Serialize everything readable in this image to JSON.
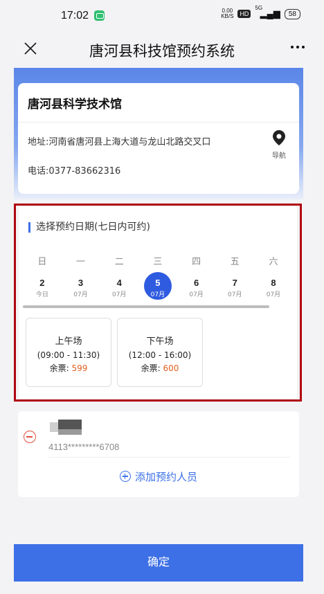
{
  "status_bar": {
    "time": "17:02",
    "net_speed_value": "0.00",
    "net_speed_unit": "KB/S",
    "hd": "HD",
    "network": "5G",
    "battery": "58"
  },
  "header": {
    "title": "唐河县科技馆预约系统"
  },
  "venue": {
    "name": "唐河县科学技术馆",
    "address": "地址:河南省唐河县上海大道与龙山北路交叉口",
    "phone": "电话:0377-83662316",
    "nav_label": "导航"
  },
  "date_picker": {
    "title": "选择预约日期(七日内可约)",
    "weekdays": [
      "日",
      "一",
      "二",
      "三",
      "四",
      "五",
      "六"
    ],
    "dates": [
      {
        "day": "2",
        "sub": "今日"
      },
      {
        "day": "3",
        "sub": "07月"
      },
      {
        "day": "4",
        "sub": "07月"
      },
      {
        "day": "5",
        "sub": "07月"
      },
      {
        "day": "6",
        "sub": "07月"
      },
      {
        "day": "7",
        "sub": "07月"
      },
      {
        "day": "8",
        "sub": "07月"
      }
    ],
    "selected_index": 3,
    "slots": [
      {
        "name": "上午场",
        "time": "(09:00 - 11:30)",
        "remain_label": "余票:",
        "remain": "599"
      },
      {
        "name": "下午场",
        "time": "(12:00 - 16:00)",
        "remain_label": "余票:",
        "remain": "600"
      }
    ]
  },
  "visitor": {
    "id_masked": "4113*********6708",
    "add_label": "添加预约人员"
  },
  "footer": {
    "confirm_label": "确定"
  },
  "colors": {
    "primary": "#3d6fe6",
    "selected_date": "#2e5be0",
    "remain_number": "#e2601f",
    "highlight_border": "#b00010",
    "remove": "#e14d3c"
  }
}
